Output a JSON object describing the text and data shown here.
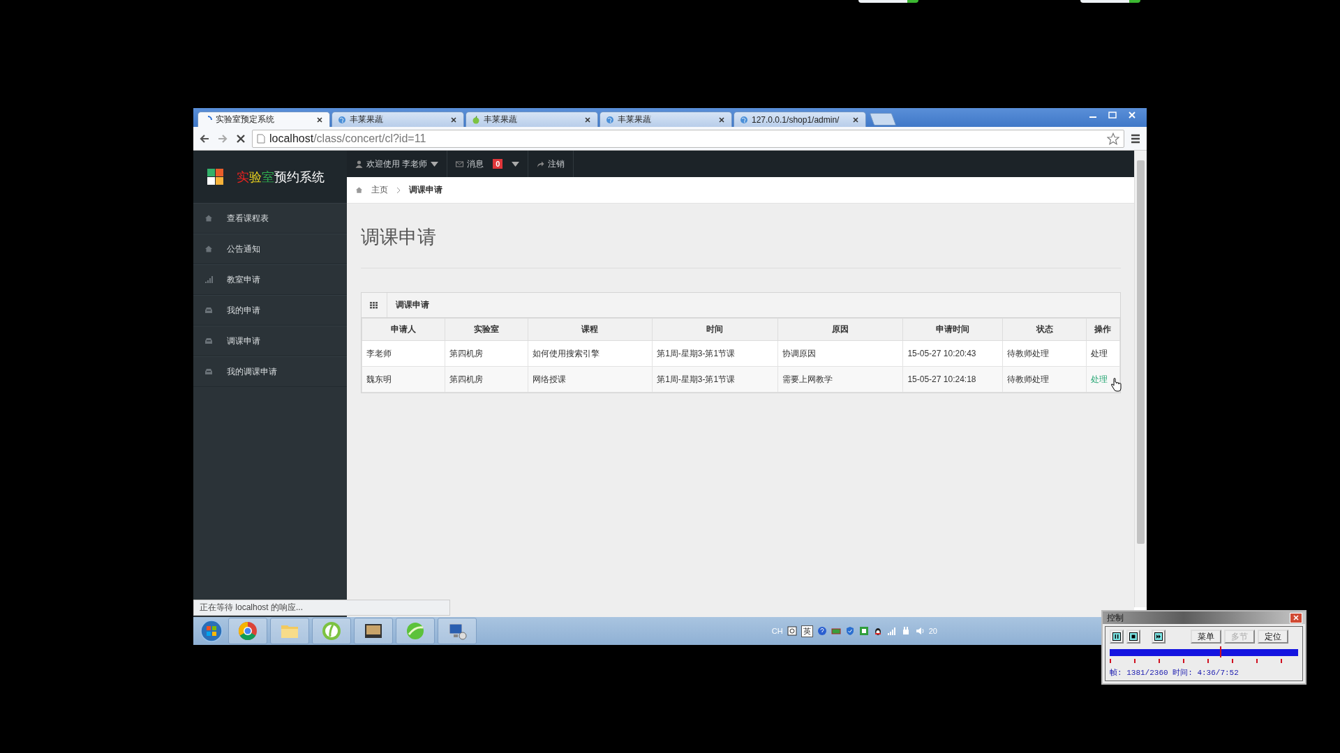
{
  "browser": {
    "tabs": [
      {
        "title": "实验室预定系统",
        "selected": true,
        "kind": "loading"
      },
      {
        "title": "丰莱果蔬",
        "selected": false,
        "kind": "globe"
      },
      {
        "title": "丰莱果蔬",
        "selected": false,
        "kind": "apple"
      },
      {
        "title": "丰莱果蔬",
        "selected": false,
        "kind": "globe"
      },
      {
        "title": "127.0.0.1/shop1/admin/",
        "selected": false,
        "kind": "globe"
      }
    ],
    "url_host": "localhost",
    "url_path": "/class/concert/cl?id=11",
    "status": "正在等待 localhost 的响应..."
  },
  "logo": [
    {
      "text": "实",
      "color": "#e8231f"
    },
    {
      "text": "验",
      "color": "#e8d11f"
    },
    {
      "text": "室",
      "color": "#2fae4f"
    },
    {
      "text": "预约系统",
      "color": "#ffffff"
    }
  ],
  "sidebar": {
    "items": [
      {
        "label": "查看课程表",
        "kind": "home"
      },
      {
        "label": "公告通知",
        "kind": "home"
      },
      {
        "label": "教室申请",
        "kind": "signal"
      },
      {
        "label": "我的申请",
        "kind": "inbox"
      },
      {
        "label": "调课申请",
        "kind": "inbox"
      },
      {
        "label": "我的调课申请",
        "kind": "inbox"
      }
    ]
  },
  "topnav": {
    "user": "欢迎使用  李老师",
    "messages": "消息",
    "message_count": "0",
    "logout": "注销"
  },
  "breadcrumb": {
    "home": "主页",
    "current": "调课申请"
  },
  "page_title": "调课申请",
  "panel": {
    "title": "调课申请",
    "table": {
      "columns": [
        "申请人",
        "实验室",
        "课程",
        "时间",
        "原因",
        "申请时间",
        "状态",
        "操作"
      ],
      "rows": [
        {
          "cells": [
            "李老师",
            "第四机房",
            "如何使用搜索引擎",
            "第1周-星期3-第1节课",
            "协调原因",
            "15-05-27 10:20:43",
            "待教师处理"
          ],
          "action": "处理",
          "hovered": false
        },
        {
          "cells": [
            "魏东明",
            "第四机房",
            "网络授课",
            "第1周-星期3-第1节课",
            "需要上网教学",
            "15-05-27 10:24:18",
            "待教师处理"
          ],
          "action": "处理",
          "hovered": true
        }
      ]
    }
  },
  "taskbar": {
    "tray_lang": "CH",
    "tray_ime": "英",
    "clock": "20"
  },
  "recorder": {
    "title": "控制",
    "buttons": [
      {
        "label": "菜单",
        "disabled": false
      },
      {
        "label": "多节",
        "disabled": true
      },
      {
        "label": "定位",
        "disabled": false
      }
    ],
    "level": 0.585,
    "readout": "帧: 1381/2360 时间: 4:36/7:52"
  }
}
